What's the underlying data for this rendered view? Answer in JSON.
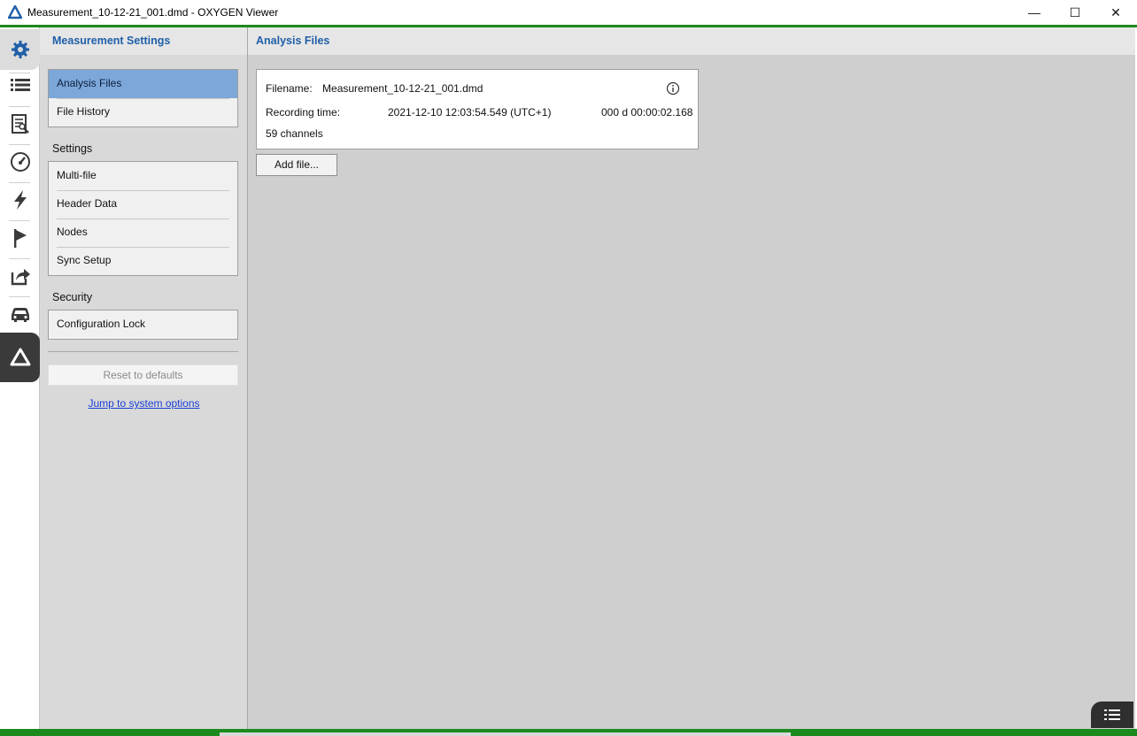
{
  "window": {
    "title": "Measurement_10-12-21_001.dmd - OXYGEN Viewer",
    "minimize_glyph": "—",
    "maximize_glyph": "☐",
    "close_glyph": "✕"
  },
  "rail": {
    "icons": [
      "gear-icon",
      "list-icon",
      "document-icon",
      "gauge-icon",
      "lightning-icon",
      "flag-icon",
      "export-icon",
      "car-icon",
      "logo-icon"
    ],
    "active": "gear-icon",
    "active_color": "#1f5fa8"
  },
  "sidebar": {
    "title": "Measurement Settings",
    "group1": [
      {
        "label": "Analysis Files",
        "selected": true
      },
      {
        "label": "File History",
        "selected": false
      }
    ],
    "settings_label": "Settings",
    "group2": [
      {
        "label": "Multi-file"
      },
      {
        "label": "Header Data"
      },
      {
        "label": "Nodes"
      },
      {
        "label": "Sync Setup"
      }
    ],
    "security_label": "Security",
    "group3": [
      {
        "label": "Configuration Lock"
      }
    ],
    "reset_label": "Reset to defaults",
    "jump_link": "Jump to system options"
  },
  "main": {
    "title": "Analysis Files",
    "file": {
      "filename_label": "Filename:",
      "filename_value": "Measurement_10-12-21_001.dmd",
      "recording_label": "Recording time:",
      "recording_value": "2021-12-10 12:03:54.549 (UTC+1)",
      "duration": "000 d 00:00:02.168",
      "channels": "59 channels"
    },
    "add_file_label": "Add file..."
  },
  "colors": {
    "accent_blue": "#1f5fa8",
    "selection": "#7da7d9",
    "status_green": "#1d8a1d"
  }
}
